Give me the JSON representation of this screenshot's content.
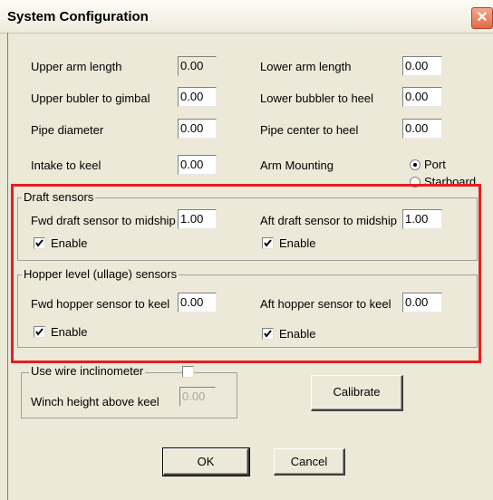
{
  "window": {
    "title": "System Configuration",
    "close_symbol": "✕",
    "close_icon": "close-icon"
  },
  "fields": {
    "upper_arm_length": {
      "label": "Upper arm length",
      "value": "0.00"
    },
    "lower_arm_length": {
      "label": "Lower arm length",
      "value": "0.00"
    },
    "upper_bubler_to_gimbal": {
      "label": "Upper bubler to gimbal",
      "value": "0.00"
    },
    "lower_bubbler_to_heel": {
      "label": "Lower bubbler to heel",
      "value": "0.00"
    },
    "pipe_diameter": {
      "label": "Pipe diameter",
      "value": "0.00"
    },
    "pipe_center_to_heel": {
      "label": "Pipe center to heel",
      "value": "0.00"
    },
    "intake_to_keel": {
      "label": "Intake to keel",
      "value": "0.00"
    }
  },
  "arm_mounting": {
    "label": "Arm Mounting",
    "options": [
      "Port",
      "Starboard"
    ],
    "selected": "Port"
  },
  "draft_sensors": {
    "legend": "Draft sensors",
    "fwd_label": "Fwd draft sensor to midship",
    "fwd_value": "1.00",
    "fwd_enable_label": "Enable",
    "fwd_enabled": true,
    "aft_label": "Aft draft sensor to midship",
    "aft_value": "1.00",
    "aft_enable_label": "Enable",
    "aft_enabled": true
  },
  "hopper_sensors": {
    "legend": "Hopper level (ullage) sensors",
    "fwd_label": "Fwd hopper sensor to keel",
    "fwd_value": "0.00",
    "fwd_enable_label": "Enable",
    "fwd_enabled": true,
    "aft_label": "Aft hopper sensor to keel",
    "aft_value": "0.00",
    "aft_enable_label": "Enable",
    "aft_enabled": true
  },
  "wire_inclinometer": {
    "label": "Use wire inclinometer",
    "checked": false,
    "winch_label": "Winch height above keel",
    "winch_value": "0.00"
  },
  "buttons": {
    "calibrate": "Calibrate",
    "ok": "OK",
    "cancel": "Cancel"
  },
  "colors": {
    "highlight_box": "#e41f1f",
    "dialog_background": "#ece9d8"
  }
}
